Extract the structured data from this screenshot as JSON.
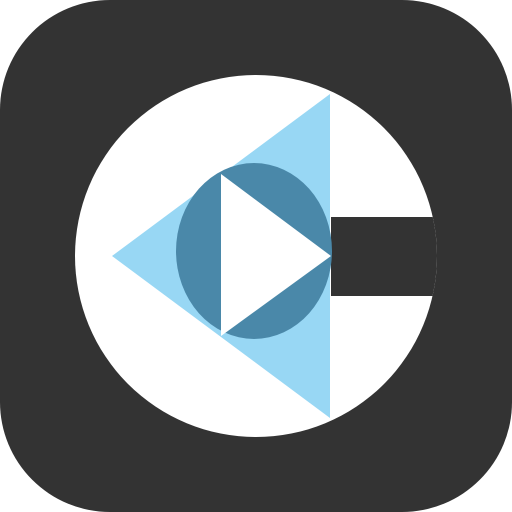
{
  "icon": {
    "name": "app-logo-icon",
    "colors": {
      "tile": "#333333",
      "disc": "#ffffff",
      "left_triangle": "#98d7f4",
      "inner_ring": "#4a88a9",
      "play_triangle": "#ffffff"
    }
  }
}
